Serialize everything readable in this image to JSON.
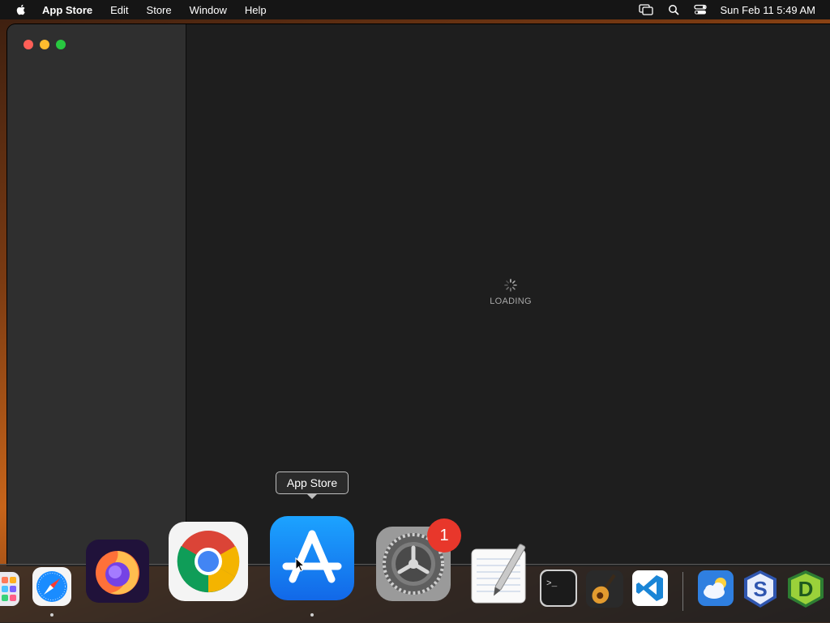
{
  "menubar": {
    "app_name": "App Store",
    "items": [
      "Edit",
      "Store",
      "Window",
      "Help"
    ],
    "clock": "Sun Feb 11  5:49 AM",
    "status_icons": [
      "screen-mirroring-icon",
      "search-icon",
      "control-center-icon"
    ]
  },
  "window": {
    "loading_text": "LOADING"
  },
  "tooltip": {
    "label": "App Store"
  },
  "dock": {
    "apps": [
      "Launchpad",
      "Safari",
      "Firefox",
      "Google Chrome",
      "App Store",
      "System Settings",
      "TextEdit",
      "Terminal",
      "GarageBand",
      "Visual Studio Code",
      "Weather",
      "Setapp",
      "Dash"
    ],
    "system_settings_badge": "1"
  },
  "colors": {
    "accent_blue": "#1a8cff",
    "badge_red": "#e8372b",
    "window_bg": "#1e1e1e",
    "sidebar_bg": "#2f2f2f"
  }
}
